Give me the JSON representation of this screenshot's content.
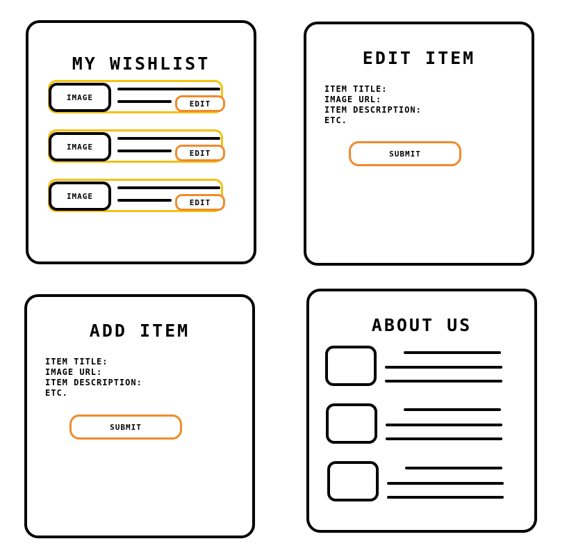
{
  "wishlist": {
    "title": "MY WISHLIST",
    "items": [
      {
        "image_label": "IMAGE",
        "edit_label": "EDIT"
      },
      {
        "image_label": "IMAGE",
        "edit_label": "EDIT"
      },
      {
        "image_label": "IMAGE",
        "edit_label": "EDIT"
      }
    ]
  },
  "edit_item": {
    "title": "EDIT ITEM",
    "fields": [
      "ITEM TITLE:",
      "IMAGE URL:",
      "ITEM DESCRIPTION:",
      "ETC."
    ],
    "submit_label": "SUBMIT"
  },
  "add_item": {
    "title": "ADD ITEM",
    "fields": [
      "ITEM TITLE:",
      "IMAGE URL:",
      "ITEM DESCRIPTION:",
      "ETC."
    ],
    "submit_label": "SUBMIT"
  },
  "about_us": {
    "title": "ABOUT US",
    "entries": 3
  },
  "colors": {
    "border": "#000000",
    "card_border": "#f5c010",
    "button_border": "#f08a2a"
  }
}
